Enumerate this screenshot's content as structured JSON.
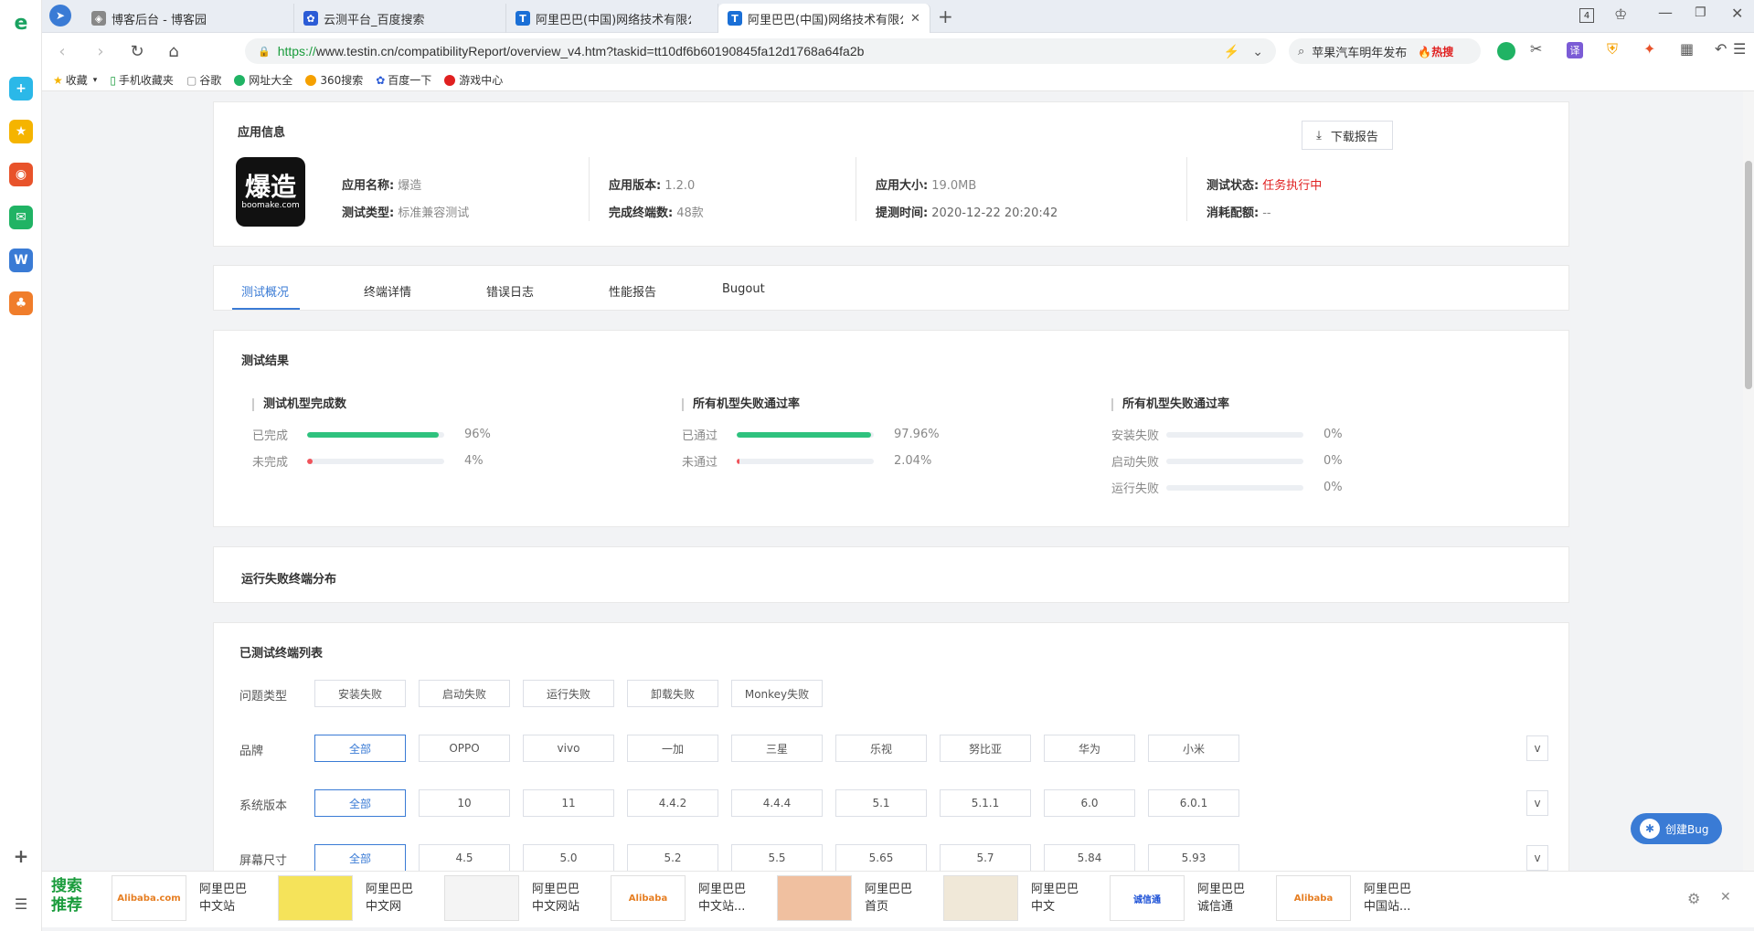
{
  "browser": {
    "tabs": [
      {
        "label": "博客后台 - 博客园",
        "active": false
      },
      {
        "label": "云测平台_百度搜索",
        "active": false
      },
      {
        "label": "阿里巴巴(中国)网络技术有限公司",
        "active": false
      },
      {
        "label": "阿里巴巴(中国)网络技术有限公司",
        "active": true
      }
    ],
    "tab_count": "4",
    "url_scheme": "https://",
    "url_rest": "www.testin.cn/compatibilityReport/overview_v4.htm?taskid=tt10df6b60190845fa12d1768a64fa2b",
    "search_text": "苹果汽车明年发布",
    "search_hot": "🔥热搜",
    "bookmarks": [
      "收藏",
      "手机收藏夹",
      "谷歌",
      "网址大全",
      "360搜索",
      "百度一下",
      "游戏中心"
    ]
  },
  "app_info": {
    "section_title": "应用信息",
    "logo_text": "爆造",
    "logo_sub": "boomake.com",
    "download_label": "下载报告",
    "fields": {
      "name_k": "应用名称:",
      "name_v": "爆造",
      "type_k": "测试类型:",
      "type_v": "标准兼容测试",
      "ver_k": "应用版本:",
      "ver_v": "1.2.0",
      "done_k": "完成终端数:",
      "done_v": "48款",
      "size_k": "应用大小:",
      "size_v": "19.0MB",
      "time_k": "提测时间:",
      "time_v": "2020-12-22 20:20:42",
      "status_k": "测试状态:",
      "status_v": "任务执行中",
      "quota_k": "消耗配额:",
      "quota_v": "--"
    }
  },
  "report_tabs": [
    "测试概况",
    "终端详情",
    "错误日志",
    "性能报告",
    "Bugout"
  ],
  "results": {
    "title": "测试结果",
    "groups": [
      {
        "title": "测试机型完成数",
        "rows": [
          {
            "label": "已完成",
            "value": 96,
            "text": "96%",
            "color": "#2ec27e"
          },
          {
            "label": "未完成",
            "value": 4,
            "text": "4%",
            "color": "#f0535a"
          }
        ]
      },
      {
        "title": "所有机型失败通过率",
        "rows": [
          {
            "label": "已通过",
            "value": 97.96,
            "text": "97.96%",
            "color": "#2ec27e"
          },
          {
            "label": "未通过",
            "value": 2.04,
            "text": "2.04%",
            "color": "#f0535a"
          }
        ]
      },
      {
        "title": "所有机型失败通过率",
        "rows": [
          {
            "label": "安装失败",
            "value": 0,
            "text": "0%",
            "color": "#f0535a"
          },
          {
            "label": "启动失败",
            "value": 0,
            "text": "0%",
            "color": "#f0535a"
          },
          {
            "label": "运行失败",
            "value": 0,
            "text": "0%",
            "color": "#f0535a"
          }
        ]
      }
    ]
  },
  "fail_dist": {
    "title": "运行失败终端分布"
  },
  "tested_list": {
    "title": "已测试终端列表",
    "filters": [
      {
        "label": "问题类型",
        "options": [
          "安装失败",
          "启动失败",
          "运行失败",
          "卸载失败",
          "Monkey失败"
        ],
        "active": -1
      },
      {
        "label": "品牌",
        "options": [
          "全部",
          "OPPO",
          "vivo",
          "一加",
          "三星",
          "乐视",
          "努比亚",
          "华为",
          "小米"
        ],
        "active": 0
      },
      {
        "label": "系统版本",
        "options": [
          "全部",
          "10",
          "11",
          "4.4.2",
          "4.4.4",
          "5.1",
          "5.1.1",
          "6.0",
          "6.0.1"
        ],
        "active": 0
      },
      {
        "label": "屏幕尺寸",
        "options": [
          "全部",
          "4.5",
          "5.0",
          "5.2",
          "5.5",
          "5.65",
          "5.7",
          "5.84",
          "5.93"
        ],
        "active": 0
      }
    ],
    "expand": "v"
  },
  "bug_button": "创建Bug",
  "recommend": {
    "label": "搜索推荐",
    "items": [
      {
        "thumb": "Alibaba.com",
        "text": "阿里巴巴\n中文站"
      },
      {
        "thumb": "",
        "text": "阿里巴巴\n中文网"
      },
      {
        "thumb": "",
        "text": "阿里巴巴\n中文网站"
      },
      {
        "thumb": "Alibaba",
        "text": "阿里巴巴\n中文站..."
      },
      {
        "thumb": "",
        "text": "阿里巴巴\n首页"
      },
      {
        "thumb": "",
        "text": "阿里巴巴\n中文"
      },
      {
        "thumb": "诚信通",
        "text": "阿里巴巴\n诚信通"
      },
      {
        "thumb": "Alibaba",
        "text": "阿里巴巴\n中国站..."
      }
    ]
  }
}
